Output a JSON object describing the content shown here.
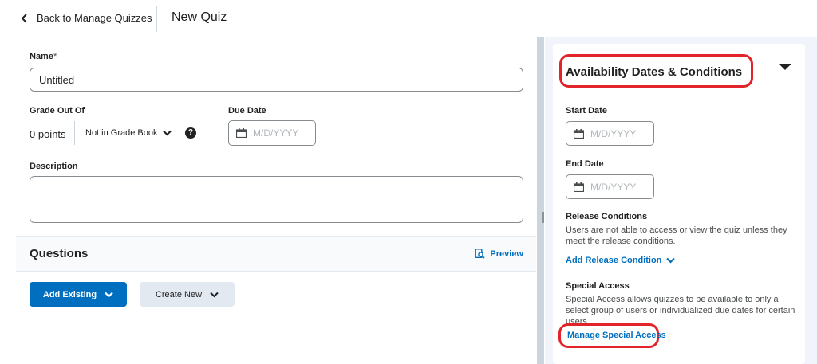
{
  "header": {
    "back_label": "Back to Manage Quizzes",
    "page_title": "New Quiz"
  },
  "form": {
    "name_label": "Name",
    "name_required_mark": "*",
    "name_value": "Untitled",
    "grade_label": "Grade Out Of",
    "grade_value": "0 points",
    "grade_book_label": "Not in Grade Book",
    "due_date_label": "Due Date",
    "date_placeholder": "M/D/YYYY",
    "description_label": "Description"
  },
  "questions": {
    "title": "Questions",
    "preview_label": "Preview",
    "add_existing_label": "Add Existing",
    "create_new_label": "Create New"
  },
  "availability": {
    "title": "Availability Dates & Conditions",
    "start_date_label": "Start Date",
    "end_date_label": "End Date",
    "release_conditions_label": "Release Conditions",
    "release_conditions_text": "Users are not able to access or view the quiz unless they meet the release conditions.",
    "add_release_condition_label": "Add Release Condition",
    "special_access_label": "Special Access",
    "special_access_text": "Special Access allows quizzes to be available to only a select group of users or individualized due dates for certain users.",
    "manage_special_access_label": "Manage Special Access"
  },
  "colors": {
    "accent_blue": "#006fbf",
    "highlight_red": "#e2232a",
    "panel_bg": "#f1f5fb"
  },
  "icons": [
    "chevron-left-icon",
    "chevron-down-icon",
    "help-icon",
    "calendar-icon",
    "preview-icon",
    "collapse-triangle-icon"
  ]
}
